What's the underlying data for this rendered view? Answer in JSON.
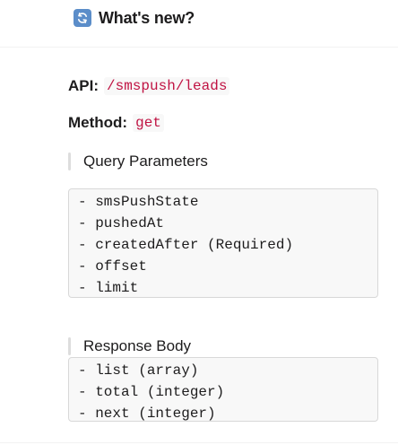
{
  "header": {
    "icon": "update-icon",
    "title": "What's new?"
  },
  "api": {
    "label": "API:",
    "value": "/smspush/leads"
  },
  "method": {
    "label": "Method:",
    "value": "get"
  },
  "query": {
    "title": "Query Parameters",
    "params": [
      "- smsPushState",
      "- pushedAt",
      "- createdAfter (Required)",
      "- offset",
      "- limit"
    ]
  },
  "response": {
    "title": "Response Body",
    "fields": [
      "- list (array)",
      "- total (integer)",
      "- next (integer)"
    ]
  },
  "colors": {
    "code_text": "#c01343",
    "icon_bg": "#5b8dc9"
  }
}
